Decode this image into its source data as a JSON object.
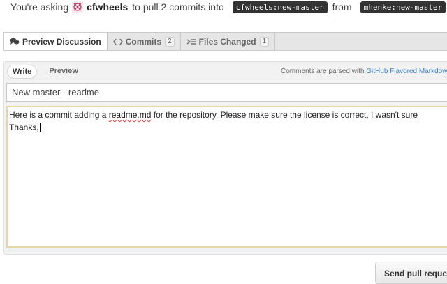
{
  "header": {
    "prefix": "You're asking",
    "repo_owner": "cfwheels",
    "middle": "to pull 2 commits into",
    "base_branch": "cfwheels:new-master",
    "from_word": "from",
    "head_branch": "mhenke:new-master"
  },
  "tabs": [
    {
      "label": "Preview Discussion",
      "icon": "discussion-icon"
    },
    {
      "label": "Commits",
      "count": "2",
      "icon": "code-icon"
    },
    {
      "label": "Files Changed",
      "count": "1",
      "icon": "diff-icon"
    }
  ],
  "editor": {
    "write_label": "Write",
    "preview_label": "Preview",
    "parsed_prefix": "Comments are parsed with",
    "parsed_link": "GitHub Flavored Markdown",
    "title_value": "New master - readme",
    "body_line1_a": "Here is a commit adding a ",
    "body_line1_word": "readme.md",
    "body_line1_b": " for the repository. Please make sure the license is correct, I wasn't sure",
    "body_line2": "Thanks,"
  },
  "send_button": "Send pull request",
  "colors": {
    "branch_bg": "#333333",
    "link": "#4183c4",
    "textarea_border": "#e7d7a8"
  }
}
